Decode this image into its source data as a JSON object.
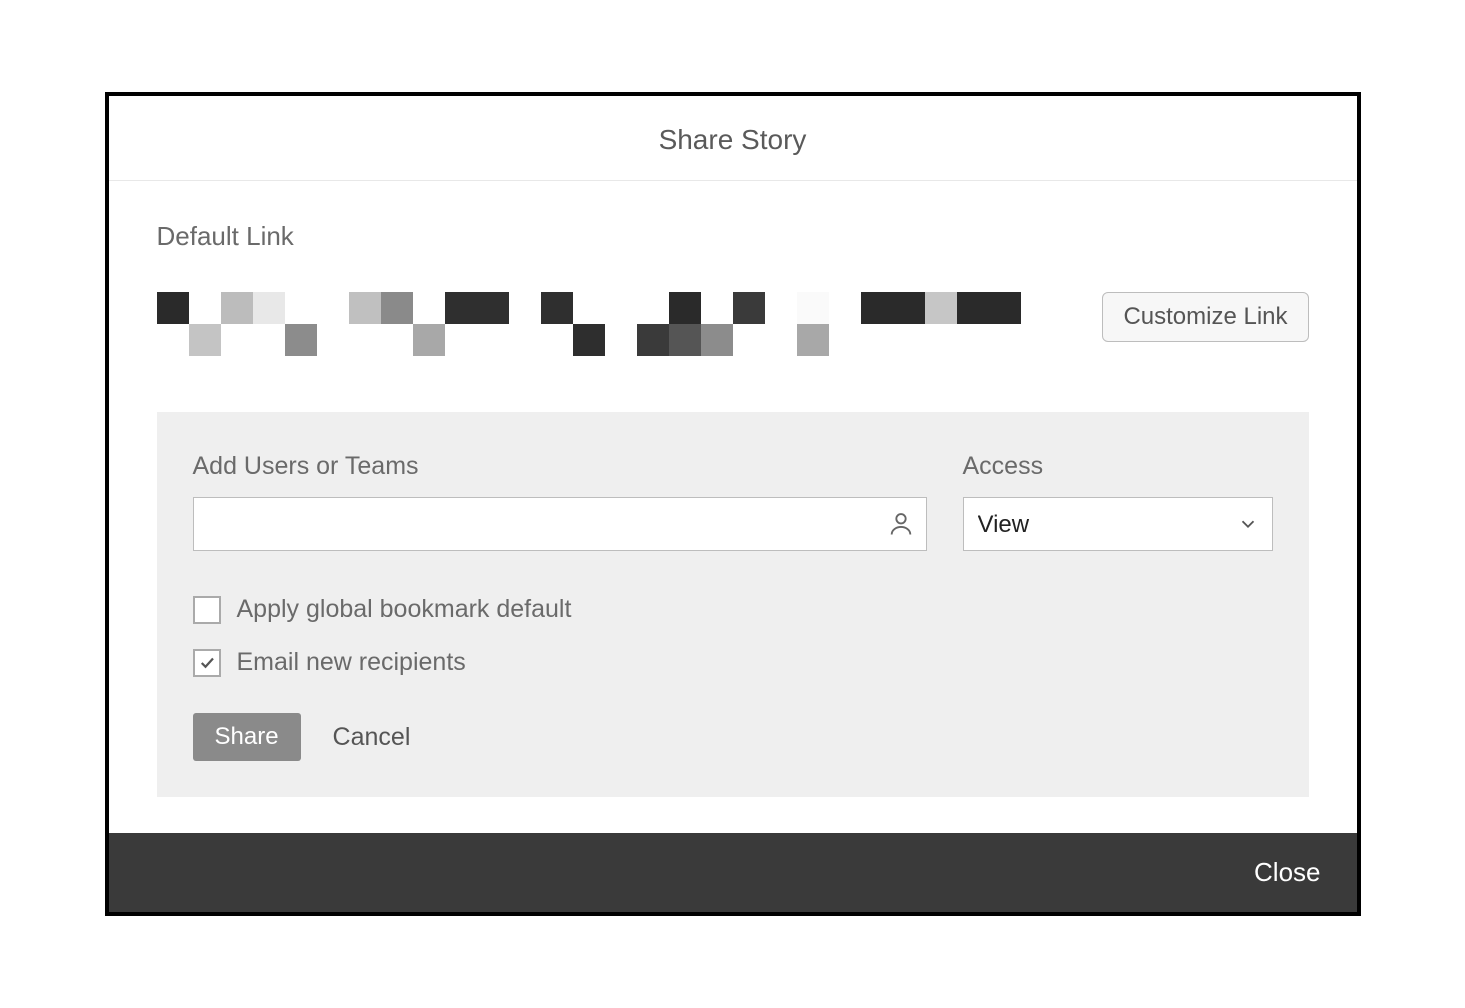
{
  "dialog": {
    "title": "Share Story",
    "default_link_label": "Default Link",
    "customize_link_label": "Customize Link"
  },
  "panel": {
    "users_label": "Add Users or Teams",
    "users_value": "",
    "access_label": "Access",
    "access_value": "View",
    "checkbox_bookmark": {
      "label": "Apply global bookmark default",
      "checked": false
    },
    "checkbox_email": {
      "label": "Email new recipients",
      "checked": true
    },
    "share_button": "Share",
    "cancel_button": "Cancel"
  },
  "footer": {
    "close_button": "Close"
  },
  "pixelated_colors_row1": [
    "#2a2a2a",
    "#ffffff",
    "#bcbcbc",
    "#e8e8e8",
    "#ffffff",
    "#ffffff",
    "#c0c0c0",
    "#8a8a8a",
    "#ffffff",
    "#2f2f2f",
    "#2f2f2f",
    "#ffffff",
    "#2f2f2f",
    "#ffffff",
    "#ffffff",
    "#ffffff",
    "#2a2a2a",
    "#ffffff",
    "#3a3a3a",
    "#ffffff",
    "#fafafa",
    "#ffffff",
    "#2a2a2a",
    "#2a2a2a",
    "#c6c6c6",
    "#2a2a2a",
    "#2a2a2a",
    "#ffffff",
    "#ffffff",
    "#c4c4c4"
  ],
  "pixelated_colors_row2": [
    "#ffffff",
    "#ffffff",
    "#8c8c8c",
    "#ffffff",
    "#ffffff",
    "#ffffff",
    "#a8a8a8",
    "#ffffff",
    "#ffffff",
    "#ffffff",
    "#ffffff",
    "#2e2e2e",
    "#ffffff",
    "#3a3a3a",
    "#555555",
    "#8c8c8c",
    "#ffffff",
    "#ffffff",
    "#a8a8a8",
    "#ffffff",
    "#ffffff",
    "#ffffff",
    "#ffffff",
    "#ffffff",
    "#ffffff",
    "#ffffff",
    "#ffffff",
    "#ffffff",
    "#ffffff",
    "#ffffff"
  ]
}
